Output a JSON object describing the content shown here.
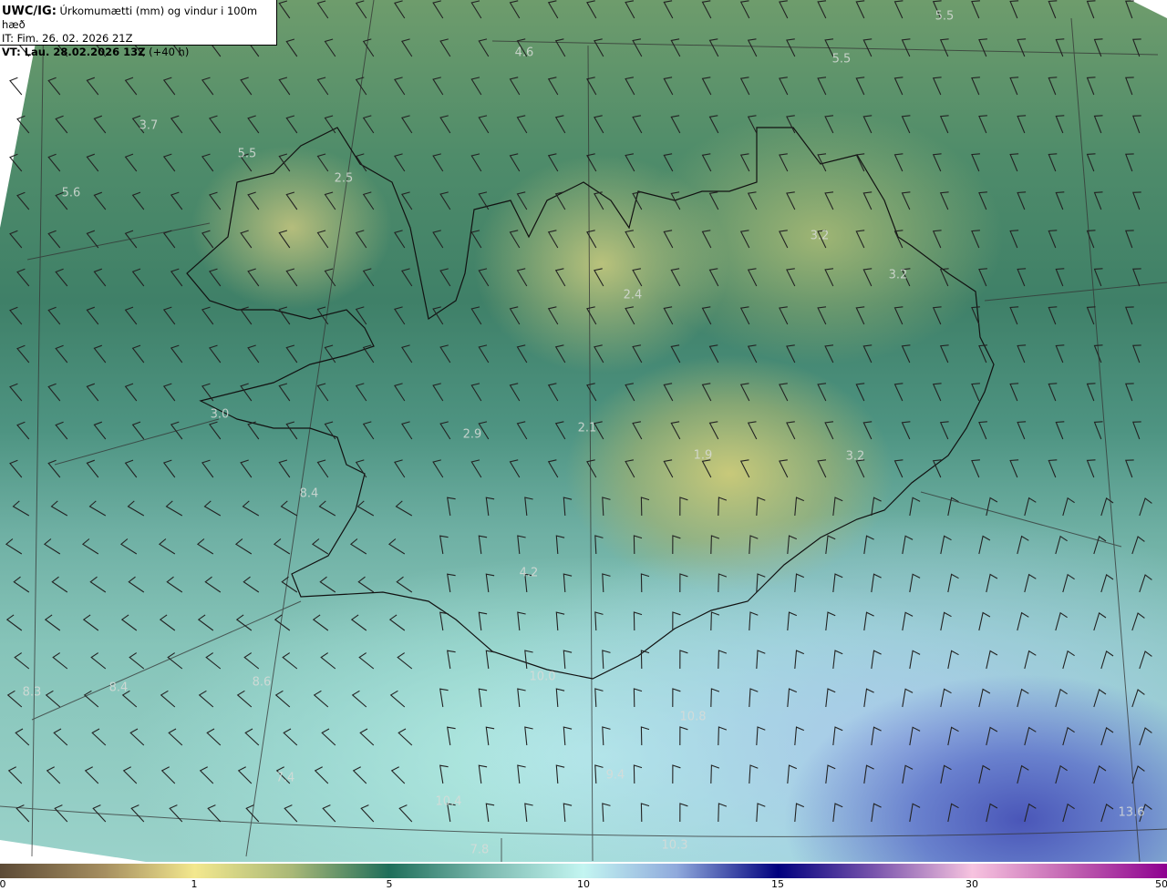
{
  "header": {
    "model": "UWC/IG:",
    "title": "Úrkomumætti (mm) og vindur i 100m hæð",
    "issue_time": "IT: Fim. 26. 02. 2026 21Z",
    "valid_label": "VT: Lau. 28.02.2026 13Z",
    "lead_time": "(+40 h)"
  },
  "map": {
    "field": "precipitable water (mm)",
    "overlay": "wind barbs 100m",
    "value_labels": [
      {
        "text": "5.5",
        "region": "north-east sea"
      },
      {
        "text": "4.6",
        "region": "north sea"
      },
      {
        "text": "5.5",
        "region": "north-east sea"
      },
      {
        "text": "3.7",
        "region": "north-west sea"
      },
      {
        "text": "5.5",
        "region": "north-west coast"
      },
      {
        "text": "5.6",
        "region": "far west sea"
      },
      {
        "text": "2.5",
        "region": "westfjords"
      },
      {
        "text": "3.2",
        "region": "north-east"
      },
      {
        "text": "3.2",
        "region": "east"
      },
      {
        "text": "2.4",
        "region": "north"
      },
      {
        "text": "3.0",
        "region": "snæfellsnes"
      },
      {
        "text": "2.9",
        "region": "langjökull"
      },
      {
        "text": "2.1",
        "region": "hofsjökull"
      },
      {
        "text": "1.9",
        "region": "vatnajökull"
      },
      {
        "text": "3.2",
        "region": "east vatnajökull"
      },
      {
        "text": "8.4",
        "region": "reykjavík"
      },
      {
        "text": "4.2",
        "region": "south"
      },
      {
        "text": "8.3",
        "region": "south-west sea"
      },
      {
        "text": "8.4",
        "region": "south-west sea"
      },
      {
        "text": "8.6",
        "region": "south-west sea"
      },
      {
        "text": "10.0",
        "region": "south coast"
      },
      {
        "text": "10.8",
        "region": "south-east sea"
      },
      {
        "text": "7.4",
        "region": "south-west sea"
      },
      {
        "text": "9.4",
        "region": "south sea"
      },
      {
        "text": "10.4",
        "region": "south sea"
      },
      {
        "text": "7.8",
        "region": "far south sea"
      },
      {
        "text": "10.3",
        "region": "far south sea"
      },
      {
        "text": "13.6",
        "region": "south-east sea"
      }
    ]
  },
  "colorbar": {
    "ticks": [
      "0",
      "1",
      "5",
      "10",
      "15",
      "30",
      "50"
    ],
    "colors": [
      "#5c4a36",
      "#f3e88e",
      "#1f6e5a",
      "#c3f5f1",
      "#00007e",
      "#f7c3df",
      "#8e0090"
    ]
  }
}
